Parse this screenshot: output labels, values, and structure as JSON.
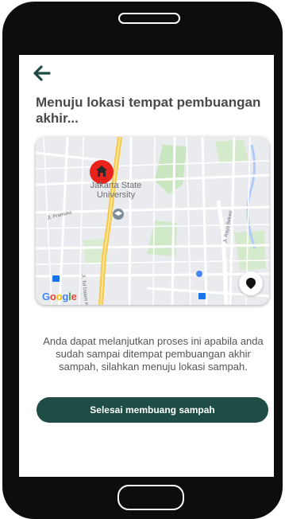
{
  "screen": {
    "back_icon": "arrow-left-icon",
    "title": "Menuju lokasi tempat pembuangan akhir...",
    "description": "Anda dapat melanjutkan proses ini apabila anda sudah sampai  ditempat pembuangan akhir sampah, silahkan menuju lokasi sampah.",
    "button_label": "Selesai membuang sampah"
  },
  "map": {
    "place_label_line1": "Jakarta State",
    "place_label_line2": "University",
    "street_1": "Jl. Pramuka",
    "street_2": "Jl. Tol Dalam Kota",
    "street_3": "Jl. Raya Bekasi",
    "google_logo": "Google",
    "pin_icon": "home-icon",
    "location_button_icon": "location-pin-icon"
  },
  "colors": {
    "primary": "#1f4d46",
    "pin": "#e8231b",
    "title_text": "#4a4a4a"
  }
}
